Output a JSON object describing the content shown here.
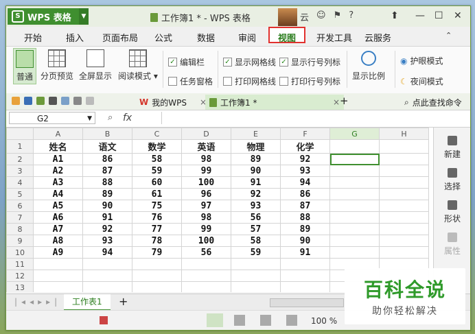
{
  "app": {
    "name": "WPS 表格",
    "doc_title": "工作簿1 * - WPS 表格",
    "user_badge": "云"
  },
  "tabs": [
    "开始",
    "插入",
    "页面布局",
    "公式",
    "数据",
    "审阅",
    "视图",
    "开发工具",
    "云服务"
  ],
  "active_tab": "视图",
  "ribbon": {
    "buttons": [
      "普通",
      "分页预览",
      "全屏显示",
      "阅读模式"
    ],
    "checks": [
      {
        "label": "编辑栏",
        "checked": true
      },
      {
        "label": "任务窗格",
        "checked": false
      },
      {
        "label": "显示网格线",
        "checked": true
      },
      {
        "label": "打印网格线",
        "checked": false
      },
      {
        "label": "显示行号列标",
        "checked": true
      },
      {
        "label": "打印行号列标",
        "checked": false
      }
    ],
    "zoom_label": "显示比例",
    "eye_mode": "护眼模式",
    "night_mode": "夜间模式"
  },
  "doctabs": {
    "wps": "我的WPS",
    "book": "工作簿1 *",
    "search": "点此查找命令"
  },
  "formula": {
    "cell_ref": "G2",
    "fx": "fx"
  },
  "columns": [
    "A",
    "B",
    "C",
    "D",
    "E",
    "F",
    "G",
    "H"
  ],
  "rows": [
    "1",
    "2",
    "3",
    "4",
    "5",
    "6",
    "7",
    "8",
    "9",
    "10",
    "11",
    "12",
    "13"
  ],
  "table": {
    "header": [
      "姓名",
      "语文",
      "数学",
      "英语",
      "物理",
      "化学"
    ],
    "data": [
      [
        "A1",
        "86",
        "58",
        "98",
        "89",
        "92"
      ],
      [
        "A2",
        "87",
        "59",
        "99",
        "90",
        "93"
      ],
      [
        "A3",
        "88",
        "60",
        "100",
        "91",
        "94"
      ],
      [
        "A4",
        "89",
        "61",
        "96",
        "92",
        "86"
      ],
      [
        "A5",
        "90",
        "75",
        "97",
        "93",
        "87"
      ],
      [
        "A6",
        "91",
        "76",
        "98",
        "56",
        "88"
      ],
      [
        "A7",
        "92",
        "77",
        "99",
        "57",
        "89"
      ],
      [
        "A8",
        "93",
        "78",
        "100",
        "58",
        "90"
      ],
      [
        "A9",
        "94",
        "79",
        "56",
        "59",
        "91"
      ]
    ]
  },
  "right_pane": [
    "新建",
    "选择",
    "形状",
    "属性"
  ],
  "sheet": {
    "name": "工作表1",
    "add": "+"
  },
  "status": {
    "zoom": "100 %"
  },
  "watermark": {
    "title": "百科全说",
    "subtitle": "助你轻松解决"
  }
}
